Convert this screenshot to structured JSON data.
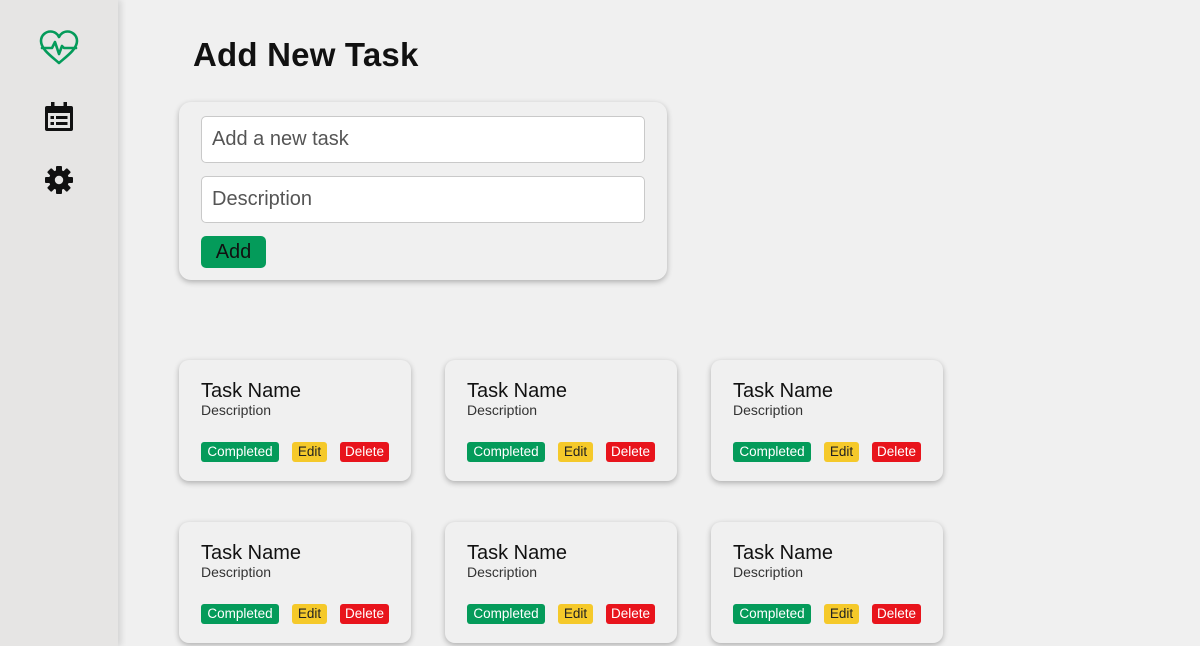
{
  "sidebar": {
    "items": [
      {
        "icon": "heart-pulse-icon",
        "color": "#049b5a"
      },
      {
        "icon": "calendar-list-icon",
        "color": "#111111"
      },
      {
        "icon": "gear-icon",
        "color": "#111111"
      }
    ]
  },
  "page": {
    "title": "Add New Task"
  },
  "form": {
    "task_placeholder": "Add a new task",
    "description_placeholder": "Description",
    "add_label": "Add"
  },
  "tasks": [
    {
      "name": "Task Name",
      "description": "Description",
      "completed_label": "Completed",
      "edit_label": "Edit",
      "delete_label": "Delete"
    },
    {
      "name": "Task Name",
      "description": "Description",
      "completed_label": "Completed",
      "edit_label": "Edit",
      "delete_label": "Delete"
    },
    {
      "name": "Task Name",
      "description": "Description",
      "completed_label": "Completed",
      "edit_label": "Edit",
      "delete_label": "Delete"
    },
    {
      "name": "Task Name",
      "description": "Description",
      "completed_label": "Completed",
      "edit_label": "Edit",
      "delete_label": "Delete"
    },
    {
      "name": "Task Name",
      "description": "Description",
      "completed_label": "Completed",
      "edit_label": "Edit",
      "delete_label": "Delete"
    },
    {
      "name": "Task Name",
      "description": "Description",
      "completed_label": "Completed",
      "edit_label": "Edit",
      "delete_label": "Delete"
    }
  ],
  "colors": {
    "accent": "#049b5a",
    "completed": "#049b5a",
    "edit": "#f5c92a",
    "delete": "#e8141c",
    "background": "#f0f0f0",
    "sidebar": "#e6e5e4"
  }
}
